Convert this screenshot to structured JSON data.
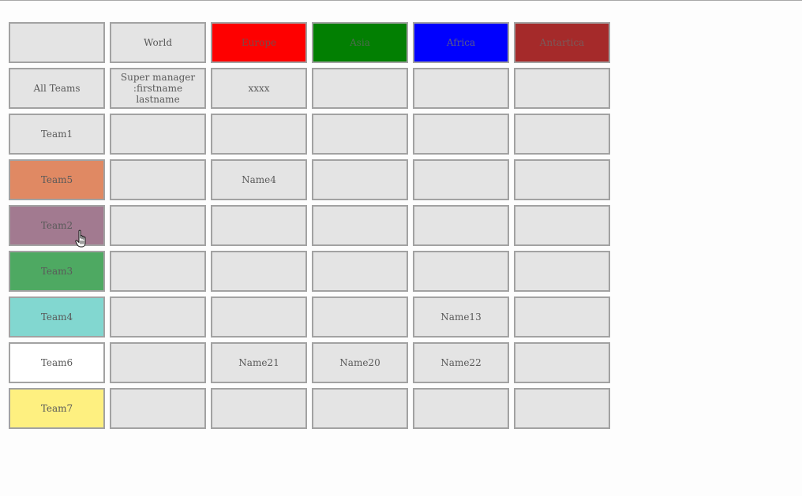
{
  "header": {
    "corner": "",
    "regions": [
      "World",
      "Europe",
      "Asia",
      "Africa",
      "Antartica"
    ],
    "region_colors": {
      "World": "#e4e4e4",
      "Europe": "#fe0000",
      "Asia": "#027f02",
      "Africa": "#0000fe",
      "Antartica": "#a52a2a"
    }
  },
  "rows": [
    {
      "team": "All Teams",
      "color": "#e4e4e4",
      "cells": [
        "Super manager\n:firstname lastname",
        "xxxx",
        "",
        "",
        ""
      ]
    },
    {
      "team": "Team1",
      "color": "#e4e4e4",
      "cells": [
        "",
        "",
        "",
        "",
        ""
      ]
    },
    {
      "team": "Team5",
      "color": "#e08963",
      "cells": [
        "",
        "Name4",
        "",
        "",
        ""
      ]
    },
    {
      "team": "Team2",
      "color": "#a27a90",
      "cells": [
        "",
        "",
        "",
        "",
        ""
      ]
    },
    {
      "team": "Team3",
      "color": "#4ea962",
      "cells": [
        "",
        "",
        "",
        "",
        ""
      ]
    },
    {
      "team": "Team4",
      "color": "#82d7d0",
      "cells": [
        "",
        "",
        "",
        "Name13",
        ""
      ]
    },
    {
      "team": "Team6",
      "color": "#ffffff",
      "cells": [
        "",
        "Name21",
        "Name20",
        "Name22",
        ""
      ]
    },
    {
      "team": "Team7",
      "color": "#fef080",
      "cells": [
        "",
        "",
        "",
        "",
        ""
      ]
    }
  ],
  "cursor_icon": "hand-pointer-icon"
}
